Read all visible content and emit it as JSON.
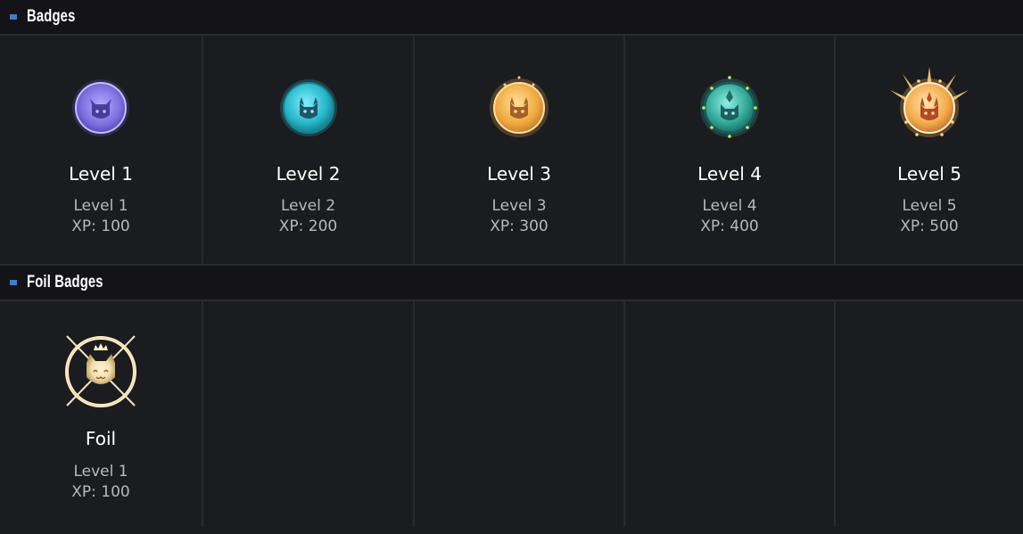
{
  "sections": [
    {
      "title": "Badges",
      "items": [
        {
          "name": "Level 1",
          "level": "Level 1",
          "xp": "XP: 100",
          "icon": "cat-badge-level-1-icon",
          "color": "#9f8df5"
        },
        {
          "name": "Level 2",
          "level": "Level 2",
          "xp": "XP: 200",
          "icon": "cat-badge-level-2-icon",
          "color": "#37c7d6"
        },
        {
          "name": "Level 3",
          "level": "Level 3",
          "xp": "XP: 300",
          "icon": "cat-badge-level-3-icon",
          "color": "#f0b04a"
        },
        {
          "name": "Level 4",
          "level": "Level 4",
          "xp": "XP: 400",
          "icon": "cat-badge-level-4-icon",
          "color": "#3bb8ac"
        },
        {
          "name": "Level 5",
          "level": "Level 5",
          "xp": "XP: 500",
          "icon": "cat-badge-level-5-icon",
          "color": "#f3b24a"
        }
      ]
    },
    {
      "title": "Foil Badges",
      "items": [
        {
          "name": "Foil",
          "level": "Level 1",
          "xp": "XP: 100",
          "icon": "foil-crown-cat-badge-icon",
          "color": "#f5e6b8"
        }
      ]
    }
  ]
}
